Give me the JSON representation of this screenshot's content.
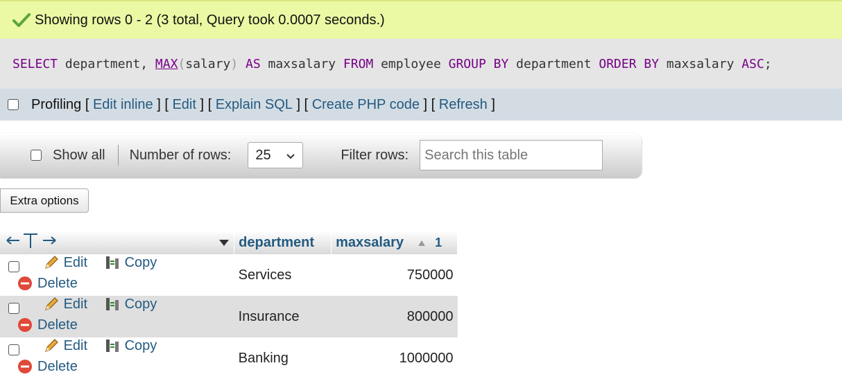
{
  "message": {
    "text": "Showing rows 0 - 2 (3 total, Query took 0.0007 seconds.)",
    "icon": "check-icon",
    "color": "#ebf8a4"
  },
  "query": {
    "select": "SELECT",
    "col1": " department, ",
    "func": "MAX",
    "paren_open": "(",
    "arg": "salary",
    "paren_close": ")",
    "as": " AS",
    "alias": " maxsalary ",
    "from": "FROM",
    "table": " employee ",
    "group_by": "GROUP BY",
    "group_col": " department ",
    "order_by": "ORDER BY",
    "order_col": " maxsalary ",
    "asc": "ASC",
    "end": ";"
  },
  "profiling": {
    "label": "Profiling",
    "links": [
      "Edit inline",
      "Edit",
      "Explain SQL",
      "Create PHP code",
      "Refresh"
    ]
  },
  "navigation": {
    "show_all": "Show all",
    "rows_label": "Number of rows:",
    "rows_value": "25",
    "filter_label": "Filter rows:",
    "filter_placeholder": "Search this table"
  },
  "extra_options": "Extra options",
  "table": {
    "columns": [
      "department",
      "maxsalary"
    ],
    "sort_index": "1",
    "actions": {
      "edit": "Edit",
      "copy": "Copy",
      "delete": "Delete"
    },
    "rows": [
      {
        "department": "Services",
        "maxsalary": "750000"
      },
      {
        "department": "Insurance",
        "maxsalary": "800000"
      },
      {
        "department": "Banking",
        "maxsalary": "1000000"
      }
    ]
  },
  "colors": {
    "link": "#235a81",
    "keyword": "#770088",
    "profiling_bg": "#d3dce3",
    "sql_bg": "#e5e5e5"
  }
}
